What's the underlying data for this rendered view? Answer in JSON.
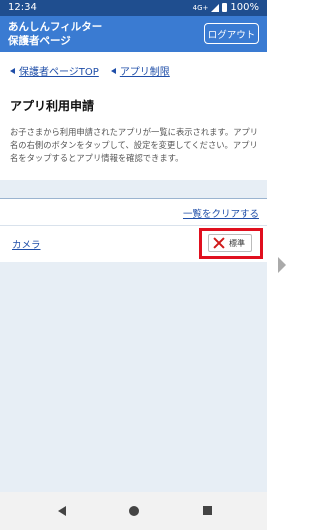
{
  "status_bar": {
    "time": "12:34",
    "network": "4G+",
    "battery": "100%"
  },
  "header": {
    "title_line1": "あんしんフィルター",
    "title_line2": "保護者ページ",
    "logout_label": "ログアウト"
  },
  "breadcrumb": {
    "items": [
      "保護者ページTOP",
      "アプリ制限"
    ]
  },
  "page": {
    "title": "アプリ利用申請",
    "description": "お子さまから利用申請されたアプリが一覧に表示されます。アプリ名の右側のボタンをタップして、設定を変更してください。アプリ名をタップするとアプリ情報を確認できます。"
  },
  "list": {
    "clear_label": "一覧をクリアする",
    "apps": [
      {
        "name": "カメラ",
        "setting_label": "標準"
      }
    ]
  },
  "colors": {
    "header_bg": "#3a7bd2",
    "status_bg": "#1f4e8f",
    "link": "#1f4ea8",
    "highlight": "#e00f1e"
  }
}
